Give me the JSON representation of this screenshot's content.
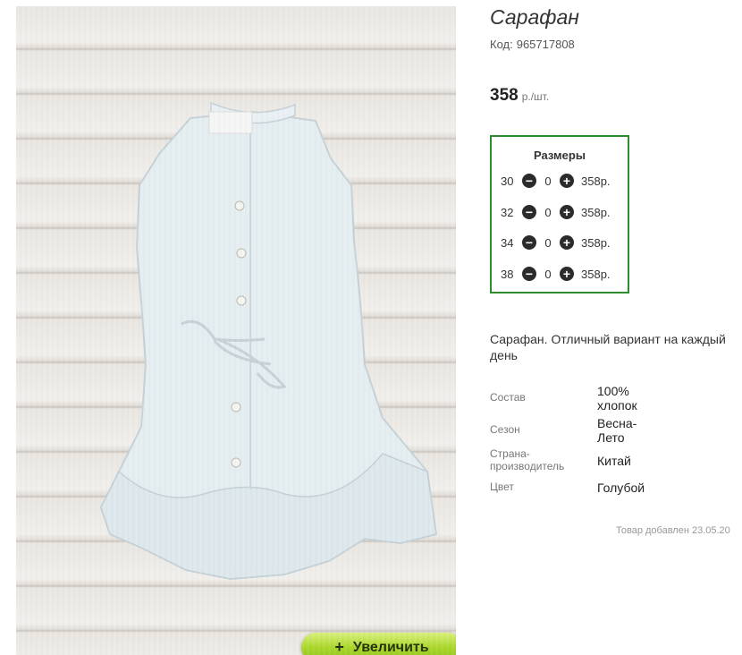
{
  "product": {
    "title": "Сарафан",
    "code_label": "Код:",
    "code": "965717808",
    "price": "358",
    "price_unit": "р./шт.",
    "zoom_label": "Увеличить"
  },
  "sizes": {
    "header": "Размеры",
    "rows": [
      {
        "size": "30",
        "qty": "0",
        "price": "358р."
      },
      {
        "size": "32",
        "qty": "0",
        "price": "358р."
      },
      {
        "size": "34",
        "qty": "0",
        "price": "358р."
      },
      {
        "size": "38",
        "qty": "0",
        "price": "358р."
      }
    ]
  },
  "description": "Сарафан. Отличный вариант на каждый день",
  "properties": [
    {
      "label": "Состав",
      "value": "100% хлопок"
    },
    {
      "label": "Сезон",
      "value": "Весна-Лето"
    },
    {
      "label": "Страна-производитель",
      "value": "Китай"
    },
    {
      "label": "Цвет",
      "value": "Голубой"
    }
  ],
  "added": "Товар добавлен 23.05.20",
  "icons": {
    "minus": "minus-circle-icon",
    "plus": "plus-circle-icon"
  },
  "colors": {
    "sizes_border": "#2e8b2e",
    "zoom_button": "#a9d626"
  }
}
